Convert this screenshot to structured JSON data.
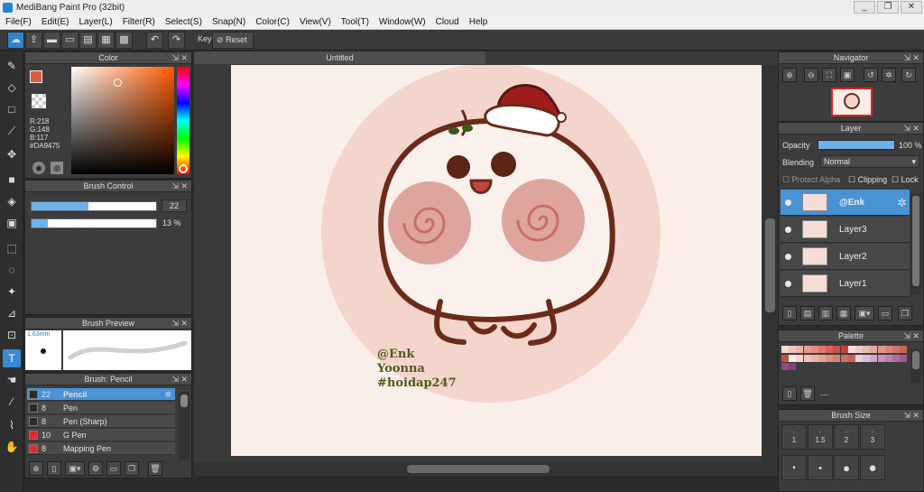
{
  "window": {
    "title": "MediBang Paint Pro (32bit)",
    "controls": [
      "_",
      "❐",
      "✕"
    ]
  },
  "menu": [
    "File(F)",
    "Edit(E)",
    "Layer(L)",
    "Filter(R)",
    "Select(S)",
    "Snap(N)",
    "Color(C)",
    "View(V)",
    "Tool(T)",
    "Window(W)",
    "Cloud",
    "Help"
  ],
  "toolbar": {
    "key_label": "Key",
    "reset_label": "Reset"
  },
  "color_panel": {
    "title": "Color",
    "r": "R:218",
    "g": "G:148",
    "b": "B:117",
    "hex": "#DA9475",
    "primary": "#DA5B3E"
  },
  "brush_control": {
    "title": "Brush Control",
    "size_value": "22",
    "opacity_value": "13 %",
    "size_fraction": 0.46,
    "opacity_fraction": 0.13
  },
  "brush_preview": {
    "title": "Brush Preview",
    "size_text": "1.63mm"
  },
  "brush_list": {
    "title": "Brush: Pencil",
    "items": [
      {
        "num": "22",
        "name": "Pencil",
        "color": "#2b2b2b",
        "selected": true
      },
      {
        "num": "8",
        "name": "Pen",
        "color": "#2b2b2b",
        "selected": false
      },
      {
        "num": "8",
        "name": "Pen (Sharp)",
        "color": "#2b2b2b",
        "selected": false
      },
      {
        "num": "10",
        "name": "G Pen",
        "color": "#e22c2c",
        "selected": false
      },
      {
        "num": "8",
        "name": "Mapping Pen",
        "color": "#e22c2c",
        "selected": false
      }
    ]
  },
  "document": {
    "tab_title": "Untitled",
    "text_lines": [
      "@Enk",
      "Yoonna",
      "#hoidap247"
    ]
  },
  "navigator": {
    "title": "Navigator"
  },
  "layer_panel": {
    "title": "Layer",
    "opacity_label": "Opacity",
    "opacity_value": "100 %",
    "blending_label": "Blending",
    "blending_value": "Normal",
    "protect_alpha": "Protect Alpha",
    "clipping": "Clipping",
    "lock": "Lock",
    "layers": [
      {
        "name": "@Enk",
        "selected": true
      },
      {
        "name": "Layer3",
        "selected": false
      },
      {
        "name": "Layer2",
        "selected": false
      },
      {
        "name": "Layer1",
        "selected": false
      }
    ]
  },
  "palette": {
    "title": "Palette",
    "name_value": "---"
  },
  "brush_size": {
    "title": "Brush Size",
    "labels": [
      "1",
      "1.5",
      "2",
      "3"
    ]
  }
}
